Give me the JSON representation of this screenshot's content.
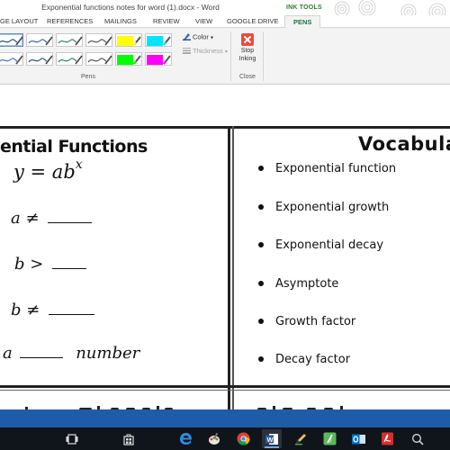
{
  "window": {
    "title": "Exponential functions notes for word (1).docx - Word"
  },
  "contextual_group": {
    "label": "INK TOOLS"
  },
  "tabs": [
    {
      "label": "GE LAYOUT"
    },
    {
      "label": "REFERENCES"
    },
    {
      "label": "MAILINGS"
    },
    {
      "label": "REVIEW"
    },
    {
      "label": "VIEW"
    },
    {
      "label": "GOOGLE DRIVE"
    },
    {
      "label": "PENS",
      "active": true
    }
  ],
  "ribbon": {
    "pens_group_label": "Pens",
    "color_label": "Color",
    "thickness_label": "Thickness",
    "stop_label_line1": "Stop",
    "stop_label_line2": "Inking",
    "close_group_label": "Close",
    "pens": [
      {
        "color": "#2b4f8e",
        "kind": "pen"
      },
      {
        "color": "#3a6ab0",
        "kind": "pen"
      },
      {
        "color": "#2e8b57",
        "kind": "pen"
      },
      {
        "color": "#555555",
        "kind": "pen"
      },
      {
        "color": "#ffff00",
        "kind": "highlighter"
      },
      {
        "color": "#00e5ff",
        "kind": "highlighter"
      },
      {
        "color": "#4a72c0",
        "kind": "pen"
      },
      {
        "color": "#2b4f8e",
        "kind": "pen"
      },
      {
        "color": "#2e8b57",
        "kind": "pen"
      },
      {
        "color": "#555555",
        "kind": "pen"
      },
      {
        "color": "#00ff00",
        "kind": "highlighter"
      },
      {
        "color": "#ff00ff",
        "kind": "highlighter"
      }
    ]
  },
  "document": {
    "left_heading": "ential Functions",
    "right_heading": "Vocabular",
    "formula": {
      "main_lhs": "y = ab",
      "main_exp": "x",
      "a_condition": "a ≠",
      "b_gt": "b >",
      "b_ne": "b ≠",
      "a_prefix": "a",
      "number_word": "number"
    },
    "vocabulary": [
      "Exponential function",
      "Exponential growth",
      "Exponential decay",
      "Asymptote",
      "Growth factor",
      "Decay factor"
    ]
  },
  "taskbar": {
    "icons": [
      {
        "name": "task-view-icon"
      },
      {
        "name": "store-icon"
      },
      {
        "name": "edge-icon"
      },
      {
        "name": "paint-icon"
      },
      {
        "name": "chrome-icon"
      },
      {
        "name": "word-icon",
        "active": true
      },
      {
        "name": "pen-tool-icon"
      },
      {
        "name": "green-app-icon"
      },
      {
        "name": "outlook-icon"
      },
      {
        "name": "acrobat-icon"
      },
      {
        "name": "search-icon"
      }
    ]
  },
  "colors": {
    "word_accent": "#217346",
    "ink_tools_green": "#2e7a2e",
    "status_bar_blue": "#1e5ca8",
    "taskbar": "#10151c",
    "stop_red": "#e74c3c"
  }
}
